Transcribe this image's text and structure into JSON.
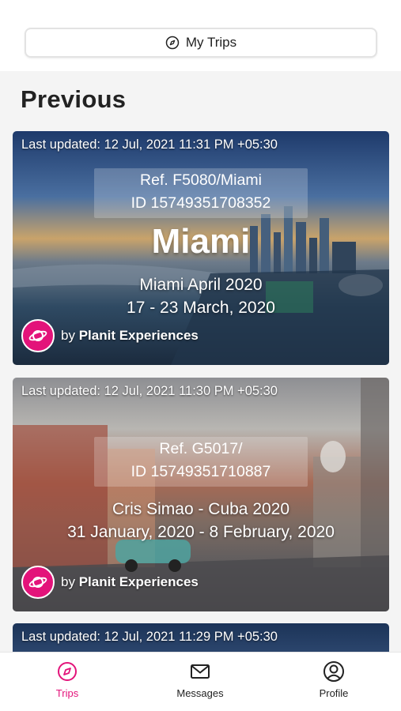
{
  "header": {
    "button_label": "My Trips",
    "icon": "compass-icon"
  },
  "section": {
    "title": "Previous"
  },
  "trips": [
    {
      "last_updated": "Last updated: 12 Jul, 2021 11:31 PM +05:30",
      "ref_line1": "Ref. F5080/Miami",
      "ref_line2": "ID 15749351708352",
      "destination": "Miami",
      "name": "Miami April 2020",
      "dates": "17 - 23 March, 2020",
      "by_prefix": "by",
      "by_company": "Planit Experiences"
    },
    {
      "last_updated": "Last updated: 12 Jul, 2021 11:30 PM +05:30",
      "ref_line1": "Ref. G5017/",
      "ref_line2": "ID 15749351710887",
      "name": "Cris Simao - Cuba 2020",
      "dates": "31 January, 2020 - 8 February, 2020",
      "by_prefix": "by",
      "by_company": "Planit Experiences"
    },
    {
      "last_updated": "Last updated: 12 Jul, 2021 11:29 PM +05:30"
    }
  ],
  "nav": {
    "items": [
      {
        "label": "Trips",
        "icon": "compass-icon",
        "active": true
      },
      {
        "label": "Messages",
        "icon": "envelope-icon",
        "active": false
      },
      {
        "label": "Profile",
        "icon": "user-circle-icon",
        "active": false
      }
    ]
  },
  "colors": {
    "accent": "#e3137a",
    "background": "#f4f4f4"
  }
}
